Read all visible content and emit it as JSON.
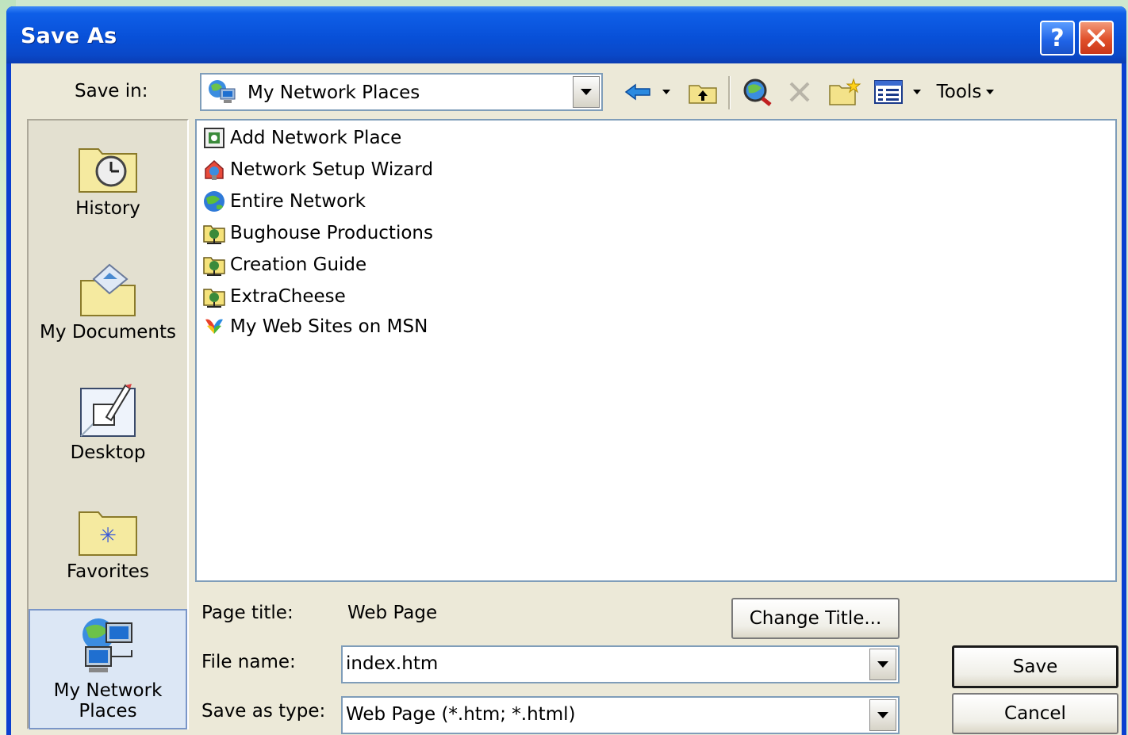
{
  "window": {
    "title": "Save As"
  },
  "save_in": {
    "label": "Save in:",
    "value": "My Network Places"
  },
  "toolbar": {
    "tools_label": "Tools"
  },
  "places": [
    {
      "label": "History",
      "icon": "history-folder-icon"
    },
    {
      "label": "My Documents",
      "icon": "my-documents-icon"
    },
    {
      "label": "Desktop",
      "icon": "desktop-icon"
    },
    {
      "label": "Favorites",
      "icon": "favorites-folder-icon"
    },
    {
      "label": "My Network Places",
      "label_line1": "My Network",
      "label_line2": "Places",
      "icon": "network-places-icon",
      "selected": true
    }
  ],
  "files": [
    {
      "label": "Add Network Place",
      "icon": "add-network-place-icon"
    },
    {
      "label": "Network Setup Wizard",
      "icon": "network-wizard-icon"
    },
    {
      "label": "Entire Network",
      "icon": "globe-icon"
    },
    {
      "label": "Bughouse Productions",
      "icon": "network-share-icon"
    },
    {
      "label": "Creation Guide",
      "icon": "network-share-icon"
    },
    {
      "label": "ExtraCheese",
      "icon": "network-share-icon"
    },
    {
      "label": "My Web Sites on MSN",
      "icon": "msn-butterfly-icon"
    }
  ],
  "page_title": {
    "label": "Page title:",
    "value": "Web Page",
    "change_button": "Change Title..."
  },
  "file_name": {
    "label": "File name:",
    "value": "index.htm"
  },
  "save_as_type": {
    "label": "Save as type:",
    "value": "Web Page (*.htm; *.html)"
  },
  "buttons": {
    "save": "Save",
    "cancel": "Cancel"
  }
}
